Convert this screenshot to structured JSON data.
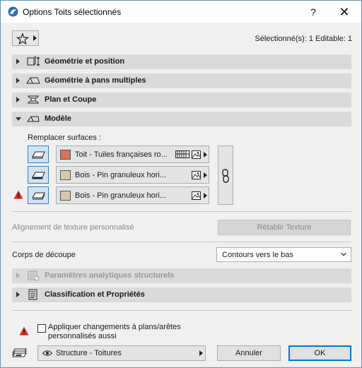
{
  "window": {
    "title": "Options Toits sélectionnés",
    "help_label": "?",
    "close_label": "✕"
  },
  "header": {
    "favorites_icon": "star-icon",
    "selection_info": "Sélectionné(s): 1 Editable: 1"
  },
  "sections": {
    "geometry": "Géométrie et position",
    "multiplane": "Géométrie à pans multiples",
    "plan_section": "Plan et Coupe",
    "model": "Modèle",
    "structural": "Paramètres analytiques structurels",
    "classification": "Classification et Propriétés"
  },
  "model": {
    "override_surfaces_label": "Remplacer surfaces :",
    "surfaces": [
      {
        "label": "Toit - Tuiles françaises ro...",
        "color": "#d9705a",
        "has_hatch": true
      },
      {
        "label": "Bois - Pin granuleux hori...",
        "color": "#d8c9ac",
        "has_hatch": false
      },
      {
        "label": "Bois - Pin granuleux hori...",
        "color": "#d8c9ac",
        "has_hatch": false
      }
    ],
    "texture_alignment_label": "Alignement de texture personnalisé",
    "reset_texture_label": "Rétablir Texture",
    "cut_body_label": "Corps de découpe",
    "cut_body_value": "Contours vers le bas"
  },
  "footer": {
    "apply_changes_label": "Appliquer changements à plans/arêtes personnalisés aussi",
    "apply_changes_checked": false,
    "layer_label": "Structure - Toitures",
    "cancel_label": "Annuler",
    "ok_label": "OK"
  },
  "colors": {
    "accent": "#0078d7",
    "warning": "#d62d20",
    "section_bg": "#dadada"
  }
}
